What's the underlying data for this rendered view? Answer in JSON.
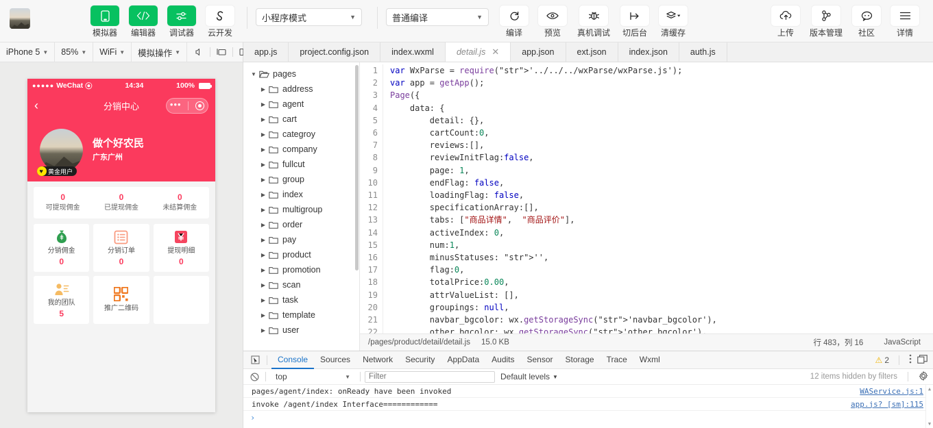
{
  "toolbar": {
    "items": [
      {
        "label": "模拟器",
        "icon": "phone-icon",
        "green": true
      },
      {
        "label": "编辑器",
        "icon": "code-icon",
        "green": true
      },
      {
        "label": "调试器",
        "icon": "sliders-icon",
        "green": true
      },
      {
        "label": "云开发",
        "icon": "cloud-dev-icon",
        "green": false
      }
    ],
    "mode_select": "小程序模式",
    "compile_select": "普通编译",
    "actions": [
      {
        "label": "编译",
        "icon": "refresh-icon"
      },
      {
        "label": "预览",
        "icon": "eye-icon"
      },
      {
        "label": "真机调试",
        "icon": "bug-icon"
      },
      {
        "label": "切后台",
        "icon": "background-icon"
      },
      {
        "label": "清缓存",
        "icon": "layers-icon",
        "caret": true
      }
    ],
    "right_actions": [
      {
        "label": "上传",
        "icon": "upload-cloud-icon"
      },
      {
        "label": "版本管理",
        "icon": "branch-icon"
      },
      {
        "label": "社区",
        "icon": "chat-icon"
      },
      {
        "label": "详情",
        "icon": "menu-icon"
      }
    ]
  },
  "simulator": {
    "toolbar": {
      "device": "iPhone 5",
      "zoom": "85%",
      "network": "WiFi",
      "operation": "模拟操作",
      "icons": [
        "volume-icon",
        "screen-icon",
        "rotate-icon",
        "plus-icon",
        "search-icon",
        "more-icon",
        "list-settings-icon"
      ]
    },
    "phone": {
      "carrier": "WeChat",
      "time": "14:34",
      "battery": "100%",
      "nav_title": "分销中心",
      "user_name": "做个好农民",
      "user_location": "广东广州",
      "vip_badge": "黄金用户",
      "stats": [
        {
          "value": "0",
          "label": "可提现佣金"
        },
        {
          "value": "0",
          "label": "已提现佣金"
        },
        {
          "value": "0",
          "label": "未结算佣金"
        }
      ],
      "grid": [
        {
          "label": "分销佣金",
          "value": "0",
          "icon": "money-bag-icon"
        },
        {
          "label": "分销订单",
          "value": "0",
          "icon": "order-list-icon"
        },
        {
          "label": "提现明细",
          "value": "0",
          "icon": "yuan-icon"
        },
        {
          "label": "我的团队",
          "value": "5",
          "icon": "team-icon"
        },
        {
          "label": "推广二维码",
          "value": "",
          "icon": "qrcode-icon"
        },
        {
          "label": "",
          "value": "",
          "icon": ""
        }
      ]
    }
  },
  "editor": {
    "tabs": [
      {
        "label": "app.js",
        "active": false,
        "closable": false
      },
      {
        "label": "project.config.json",
        "active": false,
        "closable": false
      },
      {
        "label": "index.wxml",
        "active": false,
        "closable": false
      },
      {
        "label": "detail.js",
        "active": true,
        "closable": true
      },
      {
        "label": "app.json",
        "active": false,
        "closable": false
      },
      {
        "label": "ext.json",
        "active": false,
        "closable": false
      },
      {
        "label": "index.json",
        "active": false,
        "closable": false
      },
      {
        "label": "auth.js",
        "active": false,
        "closable": false
      }
    ],
    "tree": [
      {
        "label": "pages",
        "depth": 0,
        "expanded": true
      },
      {
        "label": "address",
        "depth": 1,
        "expanded": false
      },
      {
        "label": "agent",
        "depth": 1,
        "expanded": false
      },
      {
        "label": "cart",
        "depth": 1,
        "expanded": false
      },
      {
        "label": "categroy",
        "depth": 1,
        "expanded": false
      },
      {
        "label": "company",
        "depth": 1,
        "expanded": false
      },
      {
        "label": "fullcut",
        "depth": 1,
        "expanded": false
      },
      {
        "label": "group",
        "depth": 1,
        "expanded": false
      },
      {
        "label": "index",
        "depth": 1,
        "expanded": false
      },
      {
        "label": "multigroup",
        "depth": 1,
        "expanded": false
      },
      {
        "label": "order",
        "depth": 1,
        "expanded": false
      },
      {
        "label": "pay",
        "depth": 1,
        "expanded": false
      },
      {
        "label": "product",
        "depth": 1,
        "expanded": false
      },
      {
        "label": "promotion",
        "depth": 1,
        "expanded": false
      },
      {
        "label": "scan",
        "depth": 1,
        "expanded": false
      },
      {
        "label": "task",
        "depth": 1,
        "expanded": false
      },
      {
        "label": "template",
        "depth": 1,
        "expanded": false
      },
      {
        "label": "user",
        "depth": 1,
        "expanded": false
      }
    ],
    "code_lines": [
      "var WxParse = require('../../../wxParse/wxParse.js');",
      "var app = getApp();",
      "Page({",
      "    data: {",
      "        detail: {},",
      "        cartCount:0,",
      "        reviews:[],",
      "        reviewInitFlag:false,",
      "        page: 1,",
      "        endFlag: false,",
      "        loadingFlag: false,",
      "        specificationArray:[],",
      "        tabs: [\"商品详情\",  \"商品评价\"],",
      "        activeIndex: 0,",
      "        num:1,",
      "        minusStatuses: '',",
      "        flag:0,",
      "        totalPrice:0.00,",
      "        attrValueList: [],",
      "        groupings: null,",
      "        navbar_bgcolor: wx.getStorageSync('navbar_bgcolor'),",
      "        other_bgcolor: wx.getStorageSync('other_bgcolor'),"
    ],
    "first_line_number": 1,
    "status": {
      "path": "/pages/product/detail/detail.js",
      "size": "15.0 KB",
      "position": "行 483，列 16",
      "language": "JavaScript"
    }
  },
  "console": {
    "tabs": [
      {
        "label": "Console",
        "active": true
      },
      {
        "label": "Sources",
        "active": false
      },
      {
        "label": "Network",
        "active": false
      },
      {
        "label": "Security",
        "active": false
      },
      {
        "label": "AppData",
        "active": false
      },
      {
        "label": "Audits",
        "active": false
      },
      {
        "label": "Sensor",
        "active": false
      },
      {
        "label": "Storage",
        "active": false
      },
      {
        "label": "Trace",
        "active": false
      },
      {
        "label": "Wxml",
        "active": false
      }
    ],
    "warning_count": "2",
    "context": "top",
    "filter_placeholder": "Filter",
    "filter_value": "",
    "levels": "Default levels",
    "hidden_items": "12 items hidden by filters",
    "logs": [
      {
        "text": "pages/agent/index: onReady have been invoked",
        "source": "WAService.js:1"
      },
      {
        "text": "invoke /agent/index Interface============",
        "source": "app.js? [sm]:115"
      }
    ],
    "prompt": "›"
  },
  "colors": {
    "wechat_green": "#07c160",
    "accent_pink": "#fb3a5d",
    "console_active": "#1a73c9"
  }
}
